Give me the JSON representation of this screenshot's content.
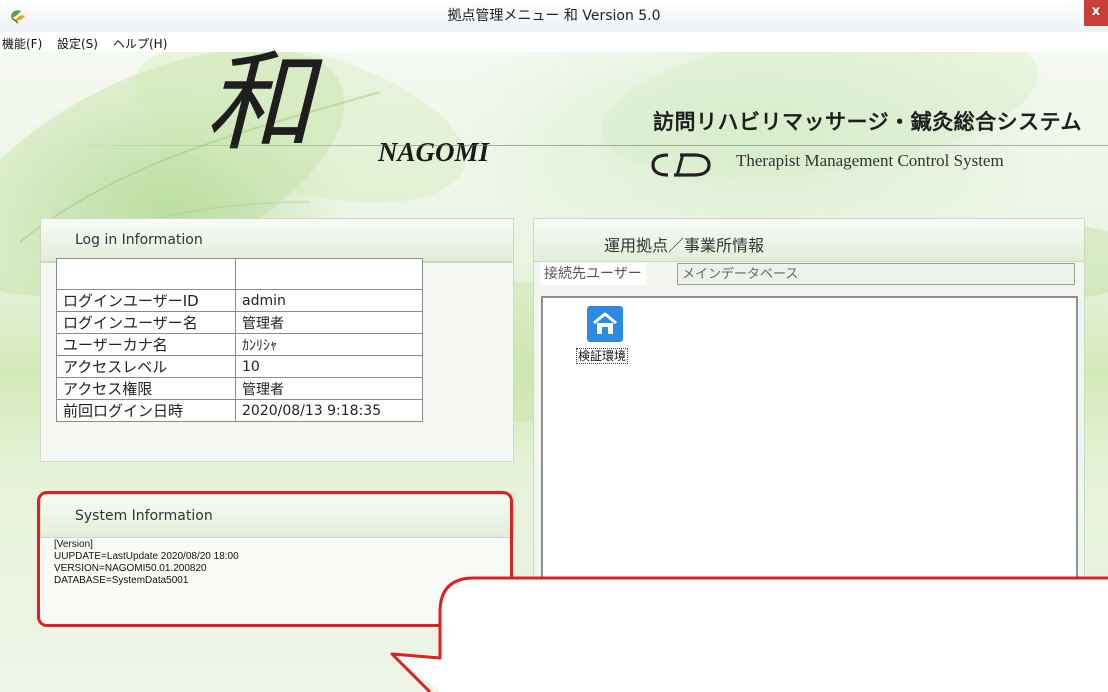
{
  "window": {
    "title": "拠点管理メニュー 和 Version 5.0",
    "close_label": "x",
    "app_icon": "app-leaf-icon"
  },
  "menu": {
    "items": [
      {
        "label": "機能(F)"
      },
      {
        "label": "設定(S)"
      },
      {
        "label": "ヘルプ(H)"
      }
    ]
  },
  "banner": {
    "logo_kanji": "和",
    "logo_text": "NAGOMI",
    "system_name_jp": "訪問リハビリマッサージ・鍼灸総合システム",
    "system_name_en": "Therapist Management Control System",
    "company_logo": "cid-logo"
  },
  "login_info": {
    "heading": "Log in Information",
    "rows": [
      {
        "key": "ログインユーザーID",
        "value": "admin"
      },
      {
        "key": "ログインユーザー名",
        "value": "管理者"
      },
      {
        "key": "ユーザーカナ名",
        "value": "ｶﾝﾘｼｬ"
      },
      {
        "key": "アクセスレベル",
        "value": "10"
      },
      {
        "key": "アクセス権限",
        "value": "管理者"
      },
      {
        "key": "前回ログイン日時",
        "value": "2020/08/13 9:18:35"
      }
    ]
  },
  "system_info": {
    "heading": "System Information",
    "text": "[Version]\nUUPDATE=LastUpdate 2020/08/20 18:00\nVERSION=NAGOMI50.01.200820\nDATABASE=SystemData5001"
  },
  "office_info": {
    "heading": "運用拠点／事業所情報",
    "connection_label": "接続先ユーザー",
    "connection_value": "メインデータベース",
    "locations": [
      {
        "label": "検証環境",
        "icon": "home-icon"
      }
    ]
  },
  "colors": {
    "accent_blue": "#2a8be0",
    "highlight_red": "#e02020",
    "close_red": "#c7403a",
    "panel_green": "#e2eed9"
  }
}
